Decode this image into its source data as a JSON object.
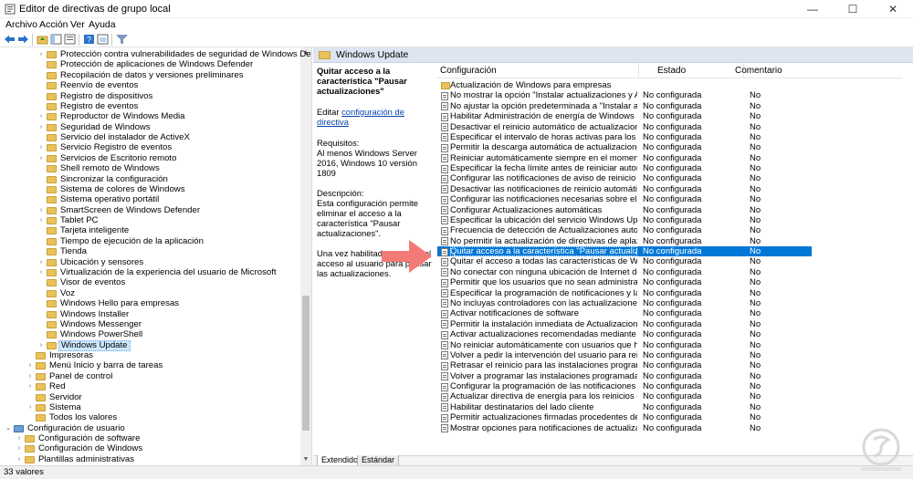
{
  "window": {
    "title": "Editor de directivas de grupo local"
  },
  "menu": [
    "Archivo",
    "Acción",
    "Ver",
    "Ayuda"
  ],
  "tree": {
    "items": [
      {
        "label": "Protección contra vulnerabilidades de seguridad de Windows Defender",
        "level": 3,
        "expand": true
      },
      {
        "label": "Protección de aplicaciones de Windows Defender",
        "level": 3,
        "expand": false
      },
      {
        "label": "Recopilación de datos y versiones preliminares",
        "level": 3,
        "expand": false
      },
      {
        "label": "Reenvío de eventos",
        "level": 3,
        "expand": false
      },
      {
        "label": "Registro de dispositivos",
        "level": 3,
        "expand": false
      },
      {
        "label": "Registro de eventos",
        "level": 3,
        "expand": false
      },
      {
        "label": "Reproductor de Windows Media",
        "level": 3,
        "expand": true
      },
      {
        "label": "Seguridad de Windows",
        "level": 3,
        "expand": true
      },
      {
        "label": "Servicio del instalador de ActiveX",
        "level": 3,
        "expand": false
      },
      {
        "label": "Servicio Registro de eventos",
        "level": 3,
        "expand": true
      },
      {
        "label": "Servicios de Escritorio remoto",
        "level": 3,
        "expand": true
      },
      {
        "label": "Shell remoto de Windows",
        "level": 3,
        "expand": false
      },
      {
        "label": "Sincronizar la configuración",
        "level": 3,
        "expand": false
      },
      {
        "label": "Sistema de colores de Windows",
        "level": 3,
        "expand": false
      },
      {
        "label": "Sistema operativo portátil",
        "level": 3,
        "expand": false
      },
      {
        "label": "SmartScreen de Windows Defender",
        "level": 3,
        "expand": true
      },
      {
        "label": "Tablet PC",
        "level": 3,
        "expand": true
      },
      {
        "label": "Tarjeta inteligente",
        "level": 3,
        "expand": false
      },
      {
        "label": "Tiempo de ejecución de la aplicación",
        "level": 3,
        "expand": false
      },
      {
        "label": "Tienda",
        "level": 3,
        "expand": false
      },
      {
        "label": "Ubicación y sensores",
        "level": 3,
        "expand": true
      },
      {
        "label": "Virtualización de la experiencia del usuario de Microsoft",
        "level": 3,
        "expand": true
      },
      {
        "label": "Visor de eventos",
        "level": 3,
        "expand": false
      },
      {
        "label": "Voz",
        "level": 3,
        "expand": false
      },
      {
        "label": "Windows Hello para empresas",
        "level": 3,
        "expand": false
      },
      {
        "label": "Windows Installer",
        "level": 3,
        "expand": false
      },
      {
        "label": "Windows Messenger",
        "level": 3,
        "expand": false
      },
      {
        "label": "Windows PowerShell",
        "level": 3,
        "expand": false
      },
      {
        "label": "Windows Update",
        "level": 3,
        "expand": true,
        "selected": true
      },
      {
        "label": "Impresoras",
        "level": 2,
        "expand": false
      },
      {
        "label": "Menú Inicio y barra de tareas",
        "level": 2,
        "expand": true
      },
      {
        "label": "Panel de control",
        "level": 2,
        "expand": true
      },
      {
        "label": "Red",
        "level": 2,
        "expand": true
      },
      {
        "label": "Servidor",
        "level": 2,
        "expand": false
      },
      {
        "label": "Sistema",
        "level": 2,
        "expand": true
      },
      {
        "label": "Todos los valores",
        "level": 2,
        "expand": false
      },
      {
        "label": "Configuración de usuario",
        "level": 0,
        "expand": true,
        "computer": true
      },
      {
        "label": "Configuración de software",
        "level": 1,
        "expand": true
      },
      {
        "label": "Configuración de Windows",
        "level": 1,
        "expand": true
      },
      {
        "label": "Plantillas administrativas",
        "level": 1,
        "expand": true
      }
    ]
  },
  "right_panel": {
    "header": "Windows Update",
    "description": {
      "title": "Quitar acceso a la característica \"Pausar actualizaciones\"",
      "edit_prefix": "Editar",
      "edit_link": "configuración de directiva",
      "requirements_label": "Requisitos:",
      "requirements_text": "Al menos Windows Server 2016, Windows 10 versión 1809",
      "description_label": "Descripción:",
      "description_text": "Esta configuración permite eliminar el acceso a la característica \"Pausar actualizaciones\".",
      "extra_text": "Una vez habilitada, se quita el acceso al usuario para pausar las actualizaciones."
    },
    "columns": [
      "Configuración",
      "Estado",
      "Comentario"
    ],
    "rows": [
      {
        "name": "Actualización de Windows para empresas",
        "state": "",
        "comment": "",
        "folder": true
      },
      {
        "name": "No mostrar la opción \"Instalar actualizaciones y Apagar\" en ...",
        "state": "No configurada",
        "comment": "No"
      },
      {
        "name": "No ajustar la opción predeterminada a \"Instalar actualizacio...",
        "state": "No configurada",
        "comment": "No"
      },
      {
        "name": "Habilitar Administración de energía de Windows Update par...",
        "state": "No configurada",
        "comment": "No"
      },
      {
        "name": "Desactivar el reinicio automático de actualizaciones durante...",
        "state": "No configurada",
        "comment": "No"
      },
      {
        "name": "Especificar el intervalo de horas activas para los reinicios aut...",
        "state": "No configurada",
        "comment": "No"
      },
      {
        "name": "Permitir la descarga automática de actualizaciones sobre co...",
        "state": "No configurada",
        "comment": "No"
      },
      {
        "name": "Reiniciar automáticamente siempre en el momento progra...",
        "state": "No configurada",
        "comment": "No"
      },
      {
        "name": "Especificar la fecha límite antes de reiniciar automáticament...",
        "state": "No configurada",
        "comment": "No"
      },
      {
        "name": "Configurar las notificaciones de aviso de reinicio automático...",
        "state": "No configurada",
        "comment": "No"
      },
      {
        "name": "Desactivar las notificaciones de reinicio automático para la...",
        "state": "No configurada",
        "comment": "No"
      },
      {
        "name": "Configurar las notificaciones necesarias sobre el reinicio aut...",
        "state": "No configurada",
        "comment": "No"
      },
      {
        "name": "Configurar Actualizaciones automáticas",
        "state": "No configurada",
        "comment": "No"
      },
      {
        "name": "Especificar la ubicación del servicio Windows Update en la i...",
        "state": "No configurada",
        "comment": "No"
      },
      {
        "name": "Frecuencia de detección de Actualizaciones automáticas",
        "state": "No configurada",
        "comment": "No"
      },
      {
        "name": "No permitir la actualización de directivas de aplazamiento a ...",
        "state": "No configurada",
        "comment": "No"
      },
      {
        "name": "Quitar acceso a la característica \"Pausar actualizaciones\"",
        "state": "No configurada",
        "comment": "No",
        "selected": true
      },
      {
        "name": "Quitar el acceso a todas las características de Windows Upd...",
        "state": "No configurada",
        "comment": "No"
      },
      {
        "name": "No conectar con ninguna ubicación de Internet de Window...",
        "state": "No configurada",
        "comment": "No"
      },
      {
        "name": "Permitir que los usuarios que no sean administradores recib...",
        "state": "No configurada",
        "comment": "No"
      },
      {
        "name": "Especificar la programación de notificaciones y la transición...",
        "state": "No configurada",
        "comment": "No"
      },
      {
        "name": "No incluyas controladores con las actualizaciones de Window...",
        "state": "No configurada",
        "comment": "No"
      },
      {
        "name": "Activar notificaciones de software",
        "state": "No configurada",
        "comment": "No"
      },
      {
        "name": "Permitir la instalación inmediata de Actualizaciones automá...",
        "state": "No configurada",
        "comment": "No"
      },
      {
        "name": "Activar actualizaciones recomendadas mediante Actualizaci...",
        "state": "No configurada",
        "comment": "No"
      },
      {
        "name": "No reiniciar automáticamente con usuarios que hayan inicia...",
        "state": "No configurada",
        "comment": "No"
      },
      {
        "name": "Volver a pedir la intervención del usuario para reiniciar con i...",
        "state": "No configurada",
        "comment": "No"
      },
      {
        "name": "Retrasar el reinicio para las instalaciones programadas",
        "state": "No configurada",
        "comment": "No"
      },
      {
        "name": "Volver a programar las instalaciones programadas de Actuali...",
        "state": "No configurada",
        "comment": "No"
      },
      {
        "name": "Configurar la programación de las notificaciones de adverte...",
        "state": "No configurada",
        "comment": "No"
      },
      {
        "name": "Actualizar directiva de energía para los reinicios del carro",
        "state": "No configurada",
        "comment": "No"
      },
      {
        "name": "Habilitar destinatarios del lado cliente",
        "state": "No configurada",
        "comment": "No"
      },
      {
        "name": "Permitir actualizaciones firmadas procedentes de una ubica...",
        "state": "No configurada",
        "comment": "No"
      },
      {
        "name": "Mostrar opciones para notificaciones de actualización",
        "state": "No configurada",
        "comment": "No"
      }
    ],
    "tabs": [
      "Extendido",
      "Estándar"
    ]
  },
  "status": {
    "text": "33 valores"
  },
  "colors": {
    "selection": "#0078d7",
    "arrow": "#f47a78",
    "header": "#dde6f0"
  }
}
